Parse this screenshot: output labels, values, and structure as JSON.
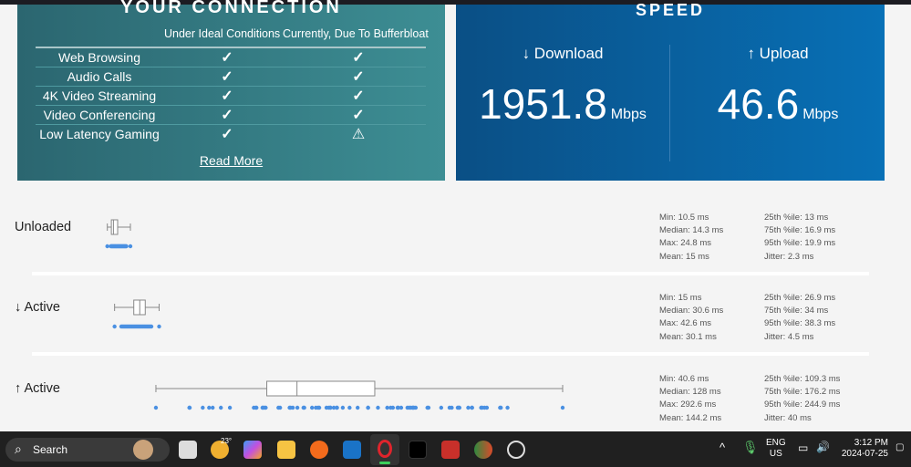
{
  "connection": {
    "title": "YOUR CONNECTION",
    "col_ideal": "Under Ideal Conditions",
    "col_current": "Currently, Due To Bufferbloat",
    "rows": [
      {
        "label": "Web Browsing",
        "ideal": "check",
        "current": "check"
      },
      {
        "label": "Audio Calls",
        "ideal": "check",
        "current": "check"
      },
      {
        "label": "4K Video Streaming",
        "ideal": "check",
        "current": "check"
      },
      {
        "label": "Video Conferencing",
        "ideal": "check",
        "current": "check"
      },
      {
        "label": "Low Latency Gaming",
        "ideal": "check",
        "current": "warning"
      }
    ],
    "read_more": "Read More"
  },
  "speed": {
    "title": "SPEED",
    "download_label": "↓ Download",
    "download_value": "1951.8",
    "download_unit": "Mbps",
    "upload_label": "↑ Upload",
    "upload_value": "46.6",
    "upload_unit": "Mbps"
  },
  "latency": [
    {
      "label": "Unloaded",
      "min": 10.5,
      "q1": 13,
      "median": 14.3,
      "q3": 16.9,
      "max": 24.8,
      "stats": [
        "Min: 10.5 ms",
        "Median: 14.3 ms",
        "Max: 24.8 ms",
        "Mean: 15 ms"
      ],
      "stats2": [
        "25th %ile: 13 ms",
        "75th %ile: 16.9 ms",
        "95th %ile: 19.9 ms",
        "Jitter: 2.3 ms"
      ]
    },
    {
      "label": "↓ Active",
      "min": 15,
      "q1": 26.9,
      "median": 30.6,
      "q3": 34,
      "max": 42.6,
      "stats": [
        "Min: 15 ms",
        "Median: 30.6 ms",
        "Max: 42.6 ms",
        "Mean: 30.1 ms"
      ],
      "stats2": [
        "25th %ile: 26.9 ms",
        "75th %ile: 34 ms",
        "95th %ile: 38.3 ms",
        "Jitter: 4.5 ms"
      ]
    },
    {
      "label": "↑ Active",
      "min": 40.6,
      "q1": 109.3,
      "median": 128,
      "q3": 176.2,
      "max": 292.6,
      "stats": [
        "Min: 40.6 ms",
        "Median: 128 ms",
        "Max: 292.6 ms",
        "Mean: 144.2 ms"
      ],
      "stats2": [
        "25th %ile: 109.3 ms",
        "75th %ile: 176.2 ms",
        "95th %ile: 244.9 ms",
        "Jitter: 40 ms"
      ]
    }
  ],
  "taskbar": {
    "search": "Search",
    "weather": "23°",
    "lang": "ENG",
    "region": "US",
    "time": "3:12 PM",
    "date": "2024-07-25"
  },
  "colors": {
    "teal": "#3a868d",
    "blue": "#0866aa",
    "dot": "#4a90e2"
  }
}
